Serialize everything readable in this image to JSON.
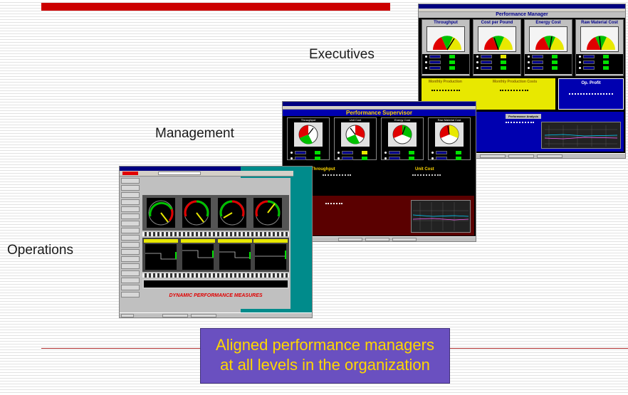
{
  "labels": {
    "executives": "Executives",
    "management": "Management",
    "operations": "Operations"
  },
  "caption": {
    "line1": "Aligned performance managers",
    "line2": "at all levels in the organization"
  },
  "executive_screen": {
    "title": "Performance Manager",
    "gauges": [
      "Throughput",
      "Cost per Pound",
      "Energy Cost",
      "Raw Material Cost"
    ],
    "panels": [
      "Monthly Production",
      "Monthly Production Costs",
      "Op. Profit"
    ],
    "analysis_title": "Performance Analysis"
  },
  "supervisor_screen": {
    "title": "Performance Supervisor",
    "gauges": [
      "Throughput",
      "Unit Cost",
      "Energy Cost",
      "Raw Material Cost"
    ],
    "sections": [
      "Throughput",
      "Unit Cost"
    ]
  },
  "operations_screen": {
    "banner": "DYNAMIC PERFORMANCE MEASURES"
  },
  "colors": {
    "accent_red": "#cc0000",
    "caption_bg": "#6a50c0",
    "caption_text": "#ffd700",
    "exec_yellow": "#e8e800",
    "exec_blue": "#0000b0",
    "ops_teal": "#008b8b"
  }
}
